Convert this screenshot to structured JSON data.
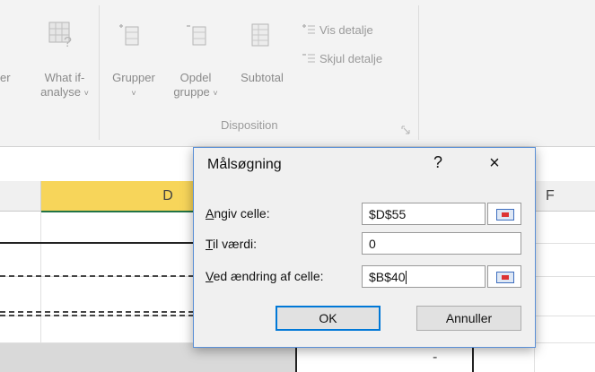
{
  "ribbon": {
    "partial_label": "er",
    "what_if_line1": "What if-",
    "what_if_line2": "analyse",
    "grupper": "Grupper",
    "opdel_line1": "Opdel",
    "opdel_line2": "gruppe",
    "subtotal": "Subtotal",
    "vis_detalje": "Vis detalje",
    "skjul_detalje": "Skjul detalje",
    "group_label": "Disposition",
    "dropdown_glyph": "˅"
  },
  "sheet": {
    "columns": [
      "D",
      "F"
    ],
    "cell_value": "-"
  },
  "dialog": {
    "title": "Målsøgning",
    "help": "?",
    "close": "×",
    "set_cell": {
      "accel": "A",
      "label_rest": "ngiv celle:",
      "value": "$D$55"
    },
    "to_value": {
      "accel": "T",
      "label_rest": "il værdi:",
      "value": "0"
    },
    "by_changing": {
      "accel": "V",
      "label_rest": "ed ændring af celle:",
      "value": "$B$40"
    },
    "ok": "OK",
    "cancel": "Annuller"
  },
  "colors": {
    "selected_column": "#f7d55a",
    "dialog_border": "#5a8fd6",
    "ok_focus": "#0078d7"
  }
}
